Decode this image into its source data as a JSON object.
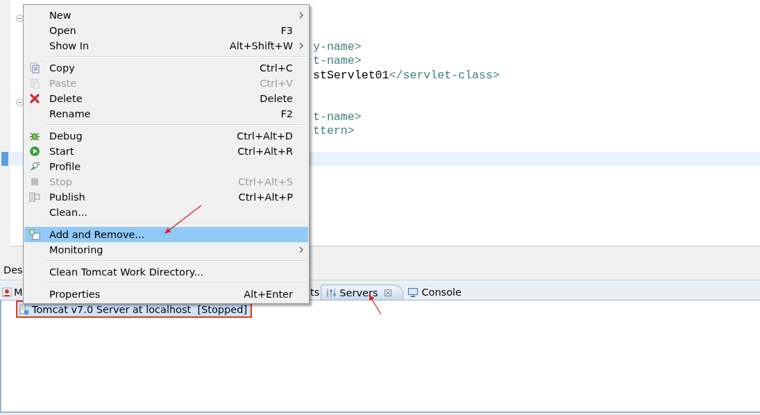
{
  "editor": {
    "lines": [
      {
        "kind": "plain"
      },
      {
        "kind": "fold-start"
      },
      {
        "kind": "plain"
      },
      {
        "kind": "plain",
        "segments": [
          {
            "kind": "tag",
            "text": "y-name>"
          }
        ]
      },
      {
        "kind": "plain",
        "segments": [
          {
            "kind": "tag",
            "text": "t-name>"
          }
        ]
      },
      {
        "kind": "plain",
        "segments": [
          {
            "kind": "text",
            "text": "stServlet01"
          },
          {
            "kind": "tag",
            "text": "</servlet-class>"
          }
        ]
      },
      {
        "kind": "plain"
      },
      {
        "kind": "fold-start"
      },
      {
        "kind": "plain",
        "segments": [
          {
            "kind": "tag",
            "text": "t-name>"
          }
        ]
      },
      {
        "kind": "plain",
        "segments": [
          {
            "kind": "tag",
            "text": "ttern>"
          }
        ]
      },
      {
        "kind": "plain"
      },
      {
        "kind": "current"
      }
    ]
  },
  "editor_tab": {
    "label": "Des"
  },
  "menu": {
    "items": [
      {
        "kind": "item",
        "label": "New",
        "submenu": true,
        "disabled": false,
        "selected": false
      },
      {
        "kind": "item",
        "label": "Open",
        "shortcut": "F3",
        "submenu": false,
        "disabled": false,
        "selected": false
      },
      {
        "kind": "item",
        "label": "Show In",
        "shortcut": "Alt+Shift+W",
        "submenu": true,
        "disabled": false,
        "selected": false
      },
      {
        "kind": "separator"
      },
      {
        "kind": "item",
        "label": "Copy",
        "shortcut": "Ctrl+C",
        "submenu": false,
        "disabled": false,
        "selected": false
      },
      {
        "kind": "item",
        "label": "Paste",
        "shortcut": "Ctrl+V",
        "submenu": false,
        "disabled": true,
        "selected": false
      },
      {
        "kind": "item",
        "label": "Delete",
        "shortcut": "Delete",
        "submenu": false,
        "disabled": false,
        "selected": false
      },
      {
        "kind": "item",
        "label": "Rename",
        "shortcut": "F2",
        "submenu": false,
        "disabled": false,
        "selected": false
      },
      {
        "kind": "separator"
      },
      {
        "kind": "item",
        "label": "Debug",
        "shortcut": "Ctrl+Alt+D",
        "submenu": false,
        "disabled": false,
        "selected": false
      },
      {
        "kind": "item",
        "label": "Start",
        "shortcut": "Ctrl+Alt+R",
        "submenu": false,
        "disabled": false,
        "selected": false
      },
      {
        "kind": "item",
        "label": "Profile",
        "submenu": false,
        "disabled": false,
        "selected": false
      },
      {
        "kind": "item",
        "label": "Stop",
        "shortcut": "Ctrl+Alt+S",
        "submenu": false,
        "disabled": true,
        "selected": false
      },
      {
        "kind": "item",
        "label": "Publish",
        "shortcut": "Ctrl+Alt+P",
        "submenu": false,
        "disabled": false,
        "selected": false
      },
      {
        "kind": "item",
        "label": "Clean...",
        "submenu": false,
        "disabled": false,
        "selected": false
      },
      {
        "kind": "separator"
      },
      {
        "kind": "item",
        "label": "Add and Remove...",
        "submenu": false,
        "disabled": false,
        "selected": true
      },
      {
        "kind": "item",
        "label": "Monitoring",
        "submenu": true,
        "disabled": false,
        "selected": false
      },
      {
        "kind": "separator"
      },
      {
        "kind": "item",
        "label": "Clean Tomcat Work Directory...",
        "submenu": false,
        "disabled": false,
        "selected": false
      },
      {
        "kind": "separator"
      },
      {
        "kind": "item",
        "label": "Properties",
        "shortcut": "Alt+Enter",
        "submenu": false,
        "disabled": false,
        "selected": false
      }
    ]
  },
  "view_tabs": [
    {
      "label": "M",
      "selected": false
    },
    {
      "label": "ts",
      "selected": false
    },
    {
      "label": "Servers",
      "selected": true
    },
    {
      "label": "Console",
      "selected": false
    }
  ],
  "servers": [
    {
      "label": "Tomcat v7.0 Server at localhost  [Stopped]",
      "selected": true,
      "annotated": true
    }
  ]
}
